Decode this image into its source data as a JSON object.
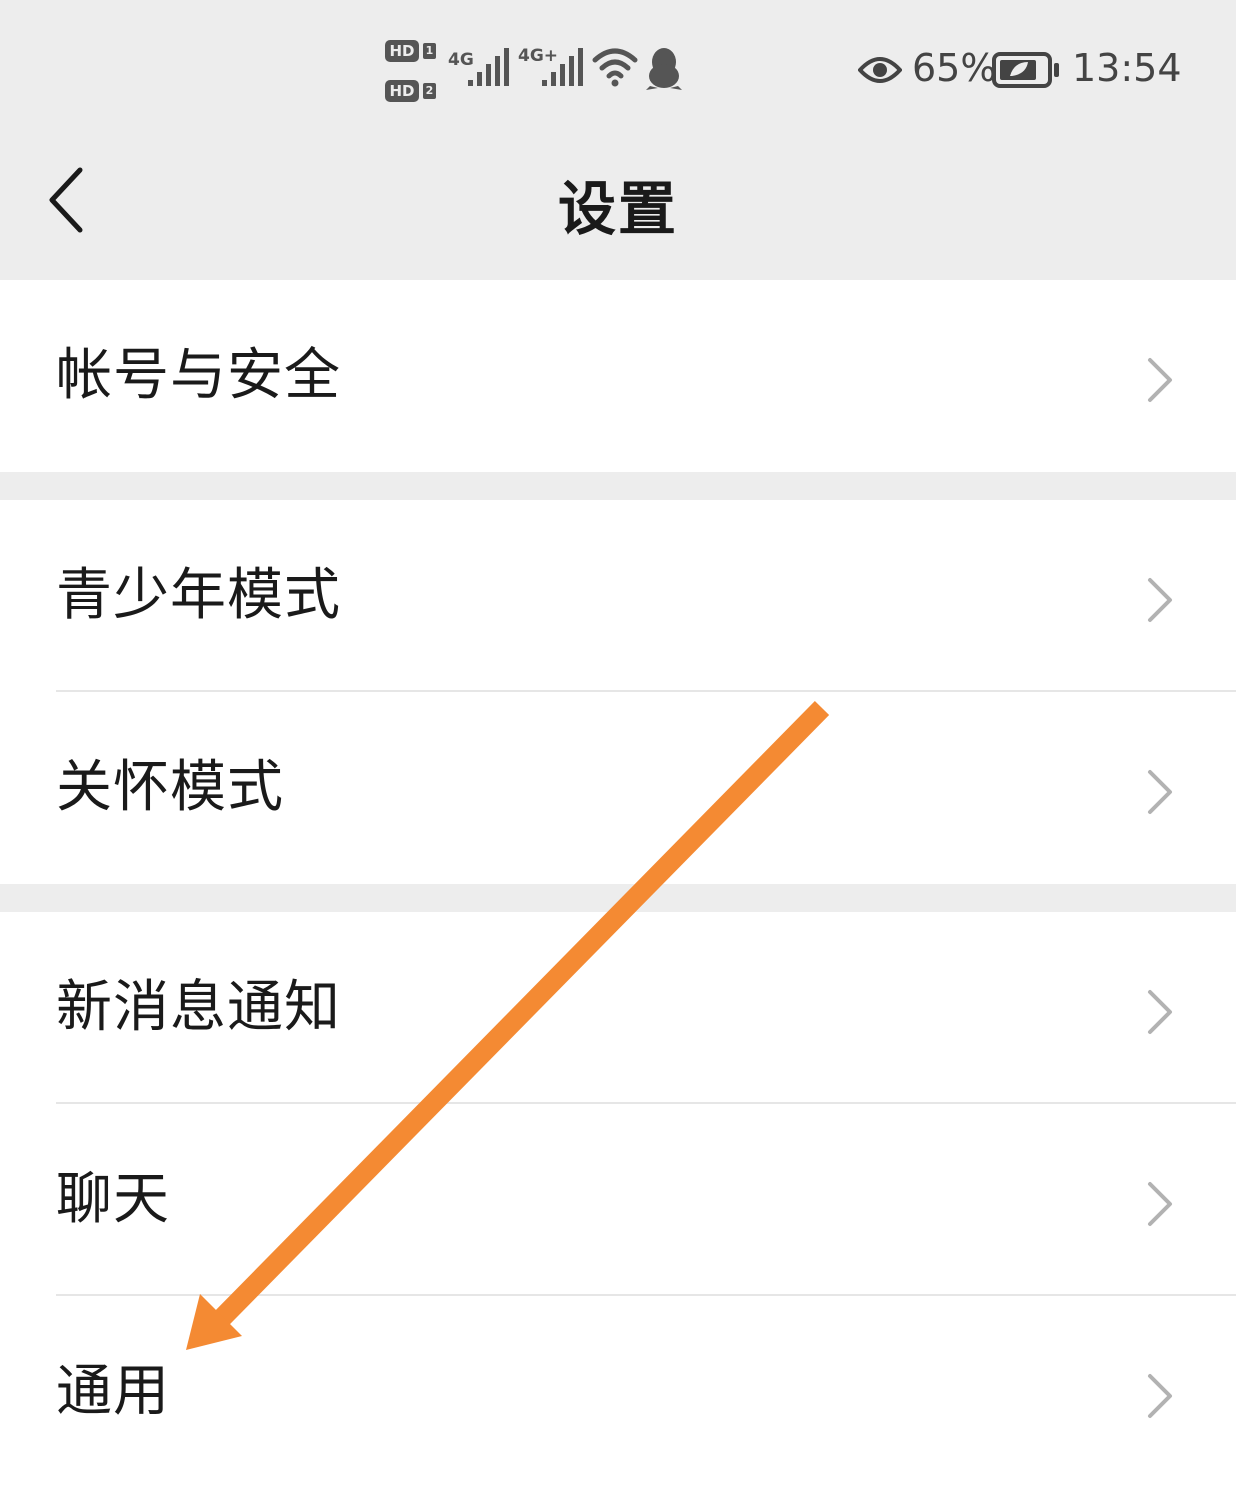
{
  "status_bar": {
    "hd1": "HD",
    "sim1": "1",
    "hd2": "HD",
    "sim2": "2",
    "net1": "4G",
    "net2": "4G+",
    "battery_percent": "65%",
    "time": "13:54",
    "icons": [
      "hd-icon",
      "signal-icon",
      "wifi-icon",
      "qq-penguin-icon",
      "eye-icon",
      "battery-icon"
    ]
  },
  "nav": {
    "title": "设置",
    "back_icon": "chevron-left-icon"
  },
  "groups": [
    {
      "items": [
        {
          "label": "帐号与安全"
        }
      ]
    },
    {
      "items": [
        {
          "label": "青少年模式"
        },
        {
          "label": "关怀模式"
        }
      ]
    },
    {
      "items": [
        {
          "label": "新消息通知"
        },
        {
          "label": "聊天"
        },
        {
          "label": "通用"
        }
      ]
    }
  ],
  "colors": {
    "background": "#ededed",
    "row_background": "#ffffff",
    "chevron": "#b2b2b2",
    "annotation_arrow": "#f48a33"
  }
}
